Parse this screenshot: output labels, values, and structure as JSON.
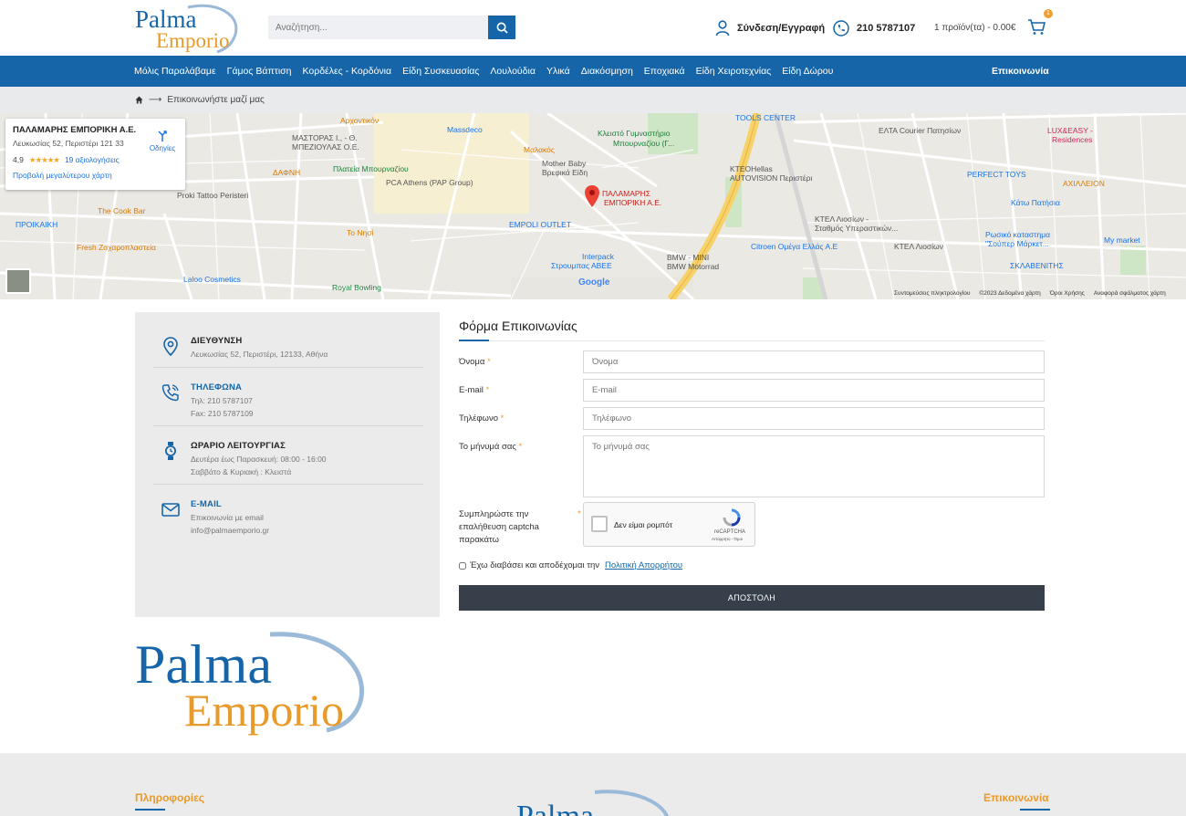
{
  "header": {
    "logo_word1": "Palma",
    "logo_word2": "Emporio",
    "search_placeholder": "Αναζήτηση...",
    "login_label": "Σύνδεση/Εγγραφή",
    "phone": "210 5787107",
    "cart_text": "1 προϊόν(τα) - 0.00€",
    "cart_count": "1"
  },
  "nav": {
    "items": [
      "Μόλις Παραλάβαμε",
      "Γάμος Βάπτιση",
      "Κορδέλες - Κορδόνια",
      "Είδη Συσκευασίας",
      "Λουλούδια",
      "Υλικά",
      "Διακόσμηση",
      "Εποχιακά",
      "Είδη Χειροτεχνίας",
      "Είδη Δώρου"
    ],
    "contact": "Επικοινωνία"
  },
  "breadcrumb": {
    "arrow": "⟶",
    "current": "Επικοινωνήστε μαζί μας"
  },
  "map": {
    "card": {
      "title": "ΠΑΛΑΜΑΡΗΣ ΕΜΠΟΡΙΚΗ Α.Ε.",
      "address": "Λευκωσίας 52, Περιστέρι 121 33",
      "rating": "4,9",
      "stars": "★★★★★",
      "reviews": "19 αξιολογήσεις",
      "bigger_map": "Προβολή μεγαλύτερου χάρτη",
      "directions": "Οδηγίες"
    },
    "labels": [
      {
        "text": "Αρχοντικόν",
        "cls": "orange"
      },
      {
        "text": "Massdeco",
        "cls": "blue"
      },
      {
        "text": "ΜΑΣΤΟΡΑΣ Ι., - Θ.",
        "cls": "grey"
      },
      {
        "text": "ΜΠΕΖΙΟΥΛΑΣ Ο.Ε.",
        "cls": "grey"
      },
      {
        "text": "Μαλακός",
        "cls": "orange"
      },
      {
        "text": "Κλειστό Γυμναστήριο",
        "cls": "green"
      },
      {
        "text": "Μπουρναζίου (Γ...",
        "cls": "green"
      },
      {
        "text": "TOOLS CENTER",
        "cls": "blue"
      },
      {
        "text": "ΕΛΤΑ Courier Πατησίων",
        "cls": "grey"
      },
      {
        "text": "LUX&EASY -",
        "cls": "pink"
      },
      {
        "text": "Residences",
        "cls": "pink"
      },
      {
        "text": "ΔΑΦΝΗ",
        "cls": "orange"
      },
      {
        "text": "Πλατεία Μπουρναζίου",
        "cls": "green"
      },
      {
        "text": "Mother Baby",
        "cls": "grey"
      },
      {
        "text": "Βρεφικά Είδη",
        "cls": "grey"
      },
      {
        "text": "ΚΤΕΟHellas",
        "cls": "grey"
      },
      {
        "text": "AUTOVISION Περιστέρι",
        "cls": "grey"
      },
      {
        "text": "PERFECT TOYS",
        "cls": "blue"
      },
      {
        "text": "ΑΧΙΛΛΕΙΟΝ",
        "cls": "orange"
      },
      {
        "text": "Proki Tattoo Peristeri",
        "cls": "grey"
      },
      {
        "text": "PCA Athens (PAP Group)",
        "cls": "grey"
      },
      {
        "text": "ΠΑΛΑΜΑΡΗΣ",
        "cls": "red"
      },
      {
        "text": "ΕΜΠΟΡΙΚΗ Α.Ε.",
        "cls": "red"
      },
      {
        "text": "Κάτω Πατήσια",
        "cls": "blue"
      },
      {
        "text": "The Cook Bar",
        "cls": "orange"
      },
      {
        "text": "ΠΡΟΙΚΑΙΚΗ",
        "cls": "blue"
      },
      {
        "text": "EMPOLI OUTLET",
        "cls": "blue"
      },
      {
        "text": "ΚΤΕΛ Λιοσίων -",
        "cls": "grey"
      },
      {
        "text": "Σταθμός Υπεραστικών...",
        "cls": "grey"
      },
      {
        "text": "Το Νησί",
        "cls": "orange"
      },
      {
        "text": "Fresh Ζαχαροπλαστεία",
        "cls": "orange"
      },
      {
        "text": "Citroen Ομέγα Ελλάς Α.Ε",
        "cls": "blue"
      },
      {
        "text": "ΚΤΕΛ Λιοσίων",
        "cls": "grey"
      },
      {
        "text": "Ρωσικό καταστημα",
        "cls": "blue"
      },
      {
        "text": "\"Σούπερ Μάρκετ...",
        "cls": "blue"
      },
      {
        "text": "My market",
        "cls": "blue"
      },
      {
        "text": "Interpack",
        "cls": "blue"
      },
      {
        "text": "Στρουμπας ΑΒΕΕ",
        "cls": "blue"
      },
      {
        "text": "BMW - MINI",
        "cls": "grey"
      },
      {
        "text": "BMW Motorrad",
        "cls": "grey"
      },
      {
        "text": "ΣΚΛΑΒΕΝΙΤΗΣ",
        "cls": "blue"
      },
      {
        "text": "Laloo Cosmetics",
        "cls": "blue"
      },
      {
        "text": "Royal Bowling",
        "cls": "green"
      }
    ],
    "footer": [
      "Συντομεύσεις πληκτρολογίου",
      "©2023 Δεδομένα χάρτη",
      "Όροι Χρήσης",
      "Αναφορά σφάλματος χάρτη"
    ],
    "google": "Google"
  },
  "info": {
    "address_title": "ΔΙΕΥΘΥΝΣΗ",
    "address": "Λευκωσίας 52, Περιστέρι, 12133, Αθήνα",
    "phone_title": "ΤΗΛΕΦΩΝΑ",
    "phone_line1": "Τηλ: 210 5787107",
    "phone_line2": "Fax: 210 5787109",
    "hours_title": "ΩΡΑΡΙΟ ΛΕΙΤΟΥΡΓΙΑΣ",
    "hours_line1": "Δευτέρα έως Παρασκευή: 08:00 - 16:00",
    "hours_line2": "Σαββάτο & Κυριακή : Κλειστά",
    "email_title": "E-MAIL",
    "email_line1": "Επικοινωνία με email",
    "email_line2": "info@palmaemporio.gr"
  },
  "form": {
    "title": "Φόρμα Επικοινωνίας",
    "name_label": "Όνομα",
    "name_placeholder": "Όνομα",
    "email_label": "E-mail",
    "email_placeholder": "E-mail",
    "phone_label": "Τηλέφωνο",
    "phone_placeholder": "Τηλέφωνο",
    "message_label": "Το μήνυμά σας",
    "message_placeholder": "Το μήνυμά σας",
    "required_mark": "*",
    "captcha_label": "Συμπληρώστε την επαλήθευση captcha παρακάτω",
    "recaptcha_text": "Δεν είμαι ρομπότ",
    "recaptcha_brand": "reCAPTCHA",
    "recaptcha_terms": "Απόρρητο - Όροι",
    "policy_text": "Έχω διαβάσει και αποδέχομαι την",
    "policy_link": "Πολιτική Απορρήτου",
    "submit": "ΑΠΟΣΤΟΛΗ"
  },
  "footer": {
    "info_title": "Πληροφορίες",
    "contact_title": "Επικοινωνία",
    "logo_word1": "Palma"
  },
  "colors": {
    "brand_blue": "#1565a8",
    "brand_orange": "#e89a2a",
    "button_dark": "#363f4a"
  }
}
